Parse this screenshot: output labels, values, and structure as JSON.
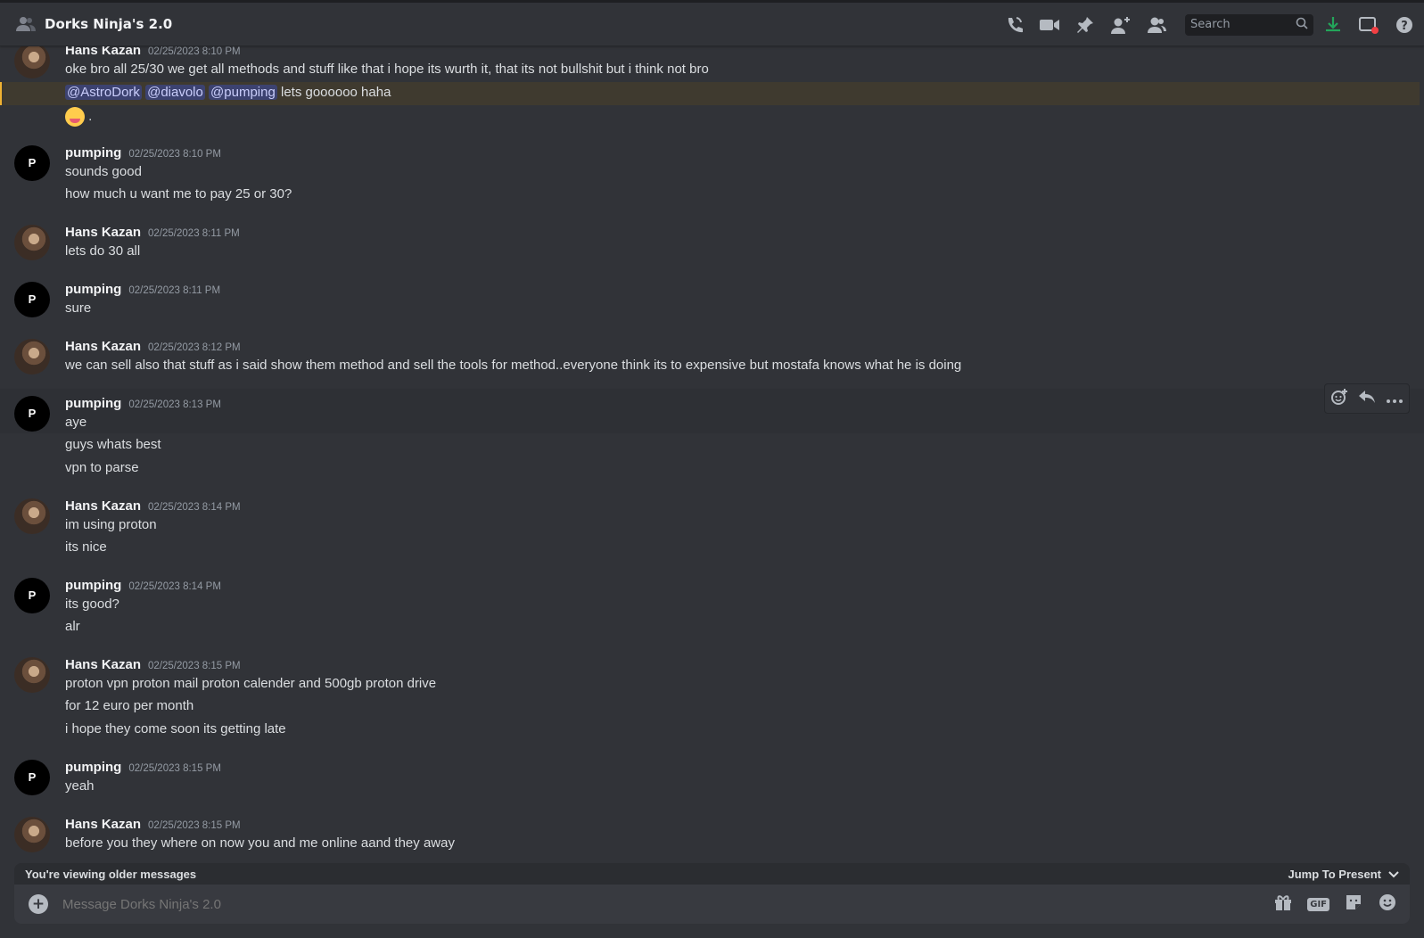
{
  "channel": {
    "title": "Dorks Ninja's 2.0"
  },
  "toolbar": {
    "icons": [
      "phone-icon",
      "video-icon",
      "pin-icon",
      "add-member-icon",
      "members-icon",
      "inbox-download-icon",
      "screen-share-icon",
      "help-icon"
    ],
    "search_placeholder": "Search"
  },
  "messages": [
    {
      "author": "Hans Kazan",
      "time": "02/25/2023 8:10 PM",
      "lines": [
        "oke bro all 25/30 we get all methods and stuff like that i hope its wurth it, that its not bullshit but i think not bro"
      ]
    },
    {
      "mentions": [
        "@AstroDork",
        "@diavolo",
        "@pumping"
      ],
      "mention_text": "lets goooooo haha",
      "emoji_suffix": "."
    },
    {
      "author": "pumping",
      "time": "02/25/2023 8:10 PM",
      "lines": [
        "sounds good",
        "how much u want me to pay 25 or 30?"
      ]
    },
    {
      "author": "Hans Kazan",
      "time": "02/25/2023 8:11 PM",
      "lines": [
        "lets do 30 all"
      ]
    },
    {
      "author": "pumping",
      "time": "02/25/2023 8:11 PM",
      "lines": [
        "sure"
      ]
    },
    {
      "author": "Hans Kazan",
      "time": "02/25/2023 8:12 PM",
      "lines": [
        "we can sell also that stuff as i said show them method and sell the tools for method..everyone think its to expensive but mostafa knows what he is doing"
      ]
    },
    {
      "author": "pumping",
      "time": "02/25/2023 8:13 PM",
      "lines": [
        "aye",
        "guys whats best",
        "vpn to parse"
      ]
    },
    {
      "author": "Hans Kazan",
      "time": "02/25/2023 8:14 PM",
      "lines": [
        "im using proton",
        "its nice"
      ]
    },
    {
      "author": "pumping",
      "time": "02/25/2023 8:14 PM",
      "lines": [
        "its good?",
        "alr"
      ]
    },
    {
      "author": "Hans Kazan",
      "time": "02/25/2023 8:15 PM",
      "lines": [
        "proton vpn proton mail proton calender and 500gb proton drive",
        "for 12 euro per month",
        "i hope they come soon its getting late"
      ]
    },
    {
      "author": "pumping",
      "time": "02/25/2023 8:15 PM",
      "lines": [
        "yeah"
      ]
    },
    {
      "author": "Hans Kazan",
      "time": "02/25/2023 8:15 PM",
      "lines": [
        "before you they where on now you and me online aand they away"
      ]
    }
  ],
  "avatar_brand": "P",
  "older_bar": {
    "text": "You're viewing older messages",
    "jump": "Jump To Present"
  },
  "composer": {
    "placeholder": "Message Dorks Ninja's 2.0",
    "gif_label": "GIF"
  },
  "colors": {
    "background": "#313338",
    "mention_highlight": "#3f3a2f",
    "mention_pill": "#3c4270",
    "download_green": "#23a55a"
  }
}
